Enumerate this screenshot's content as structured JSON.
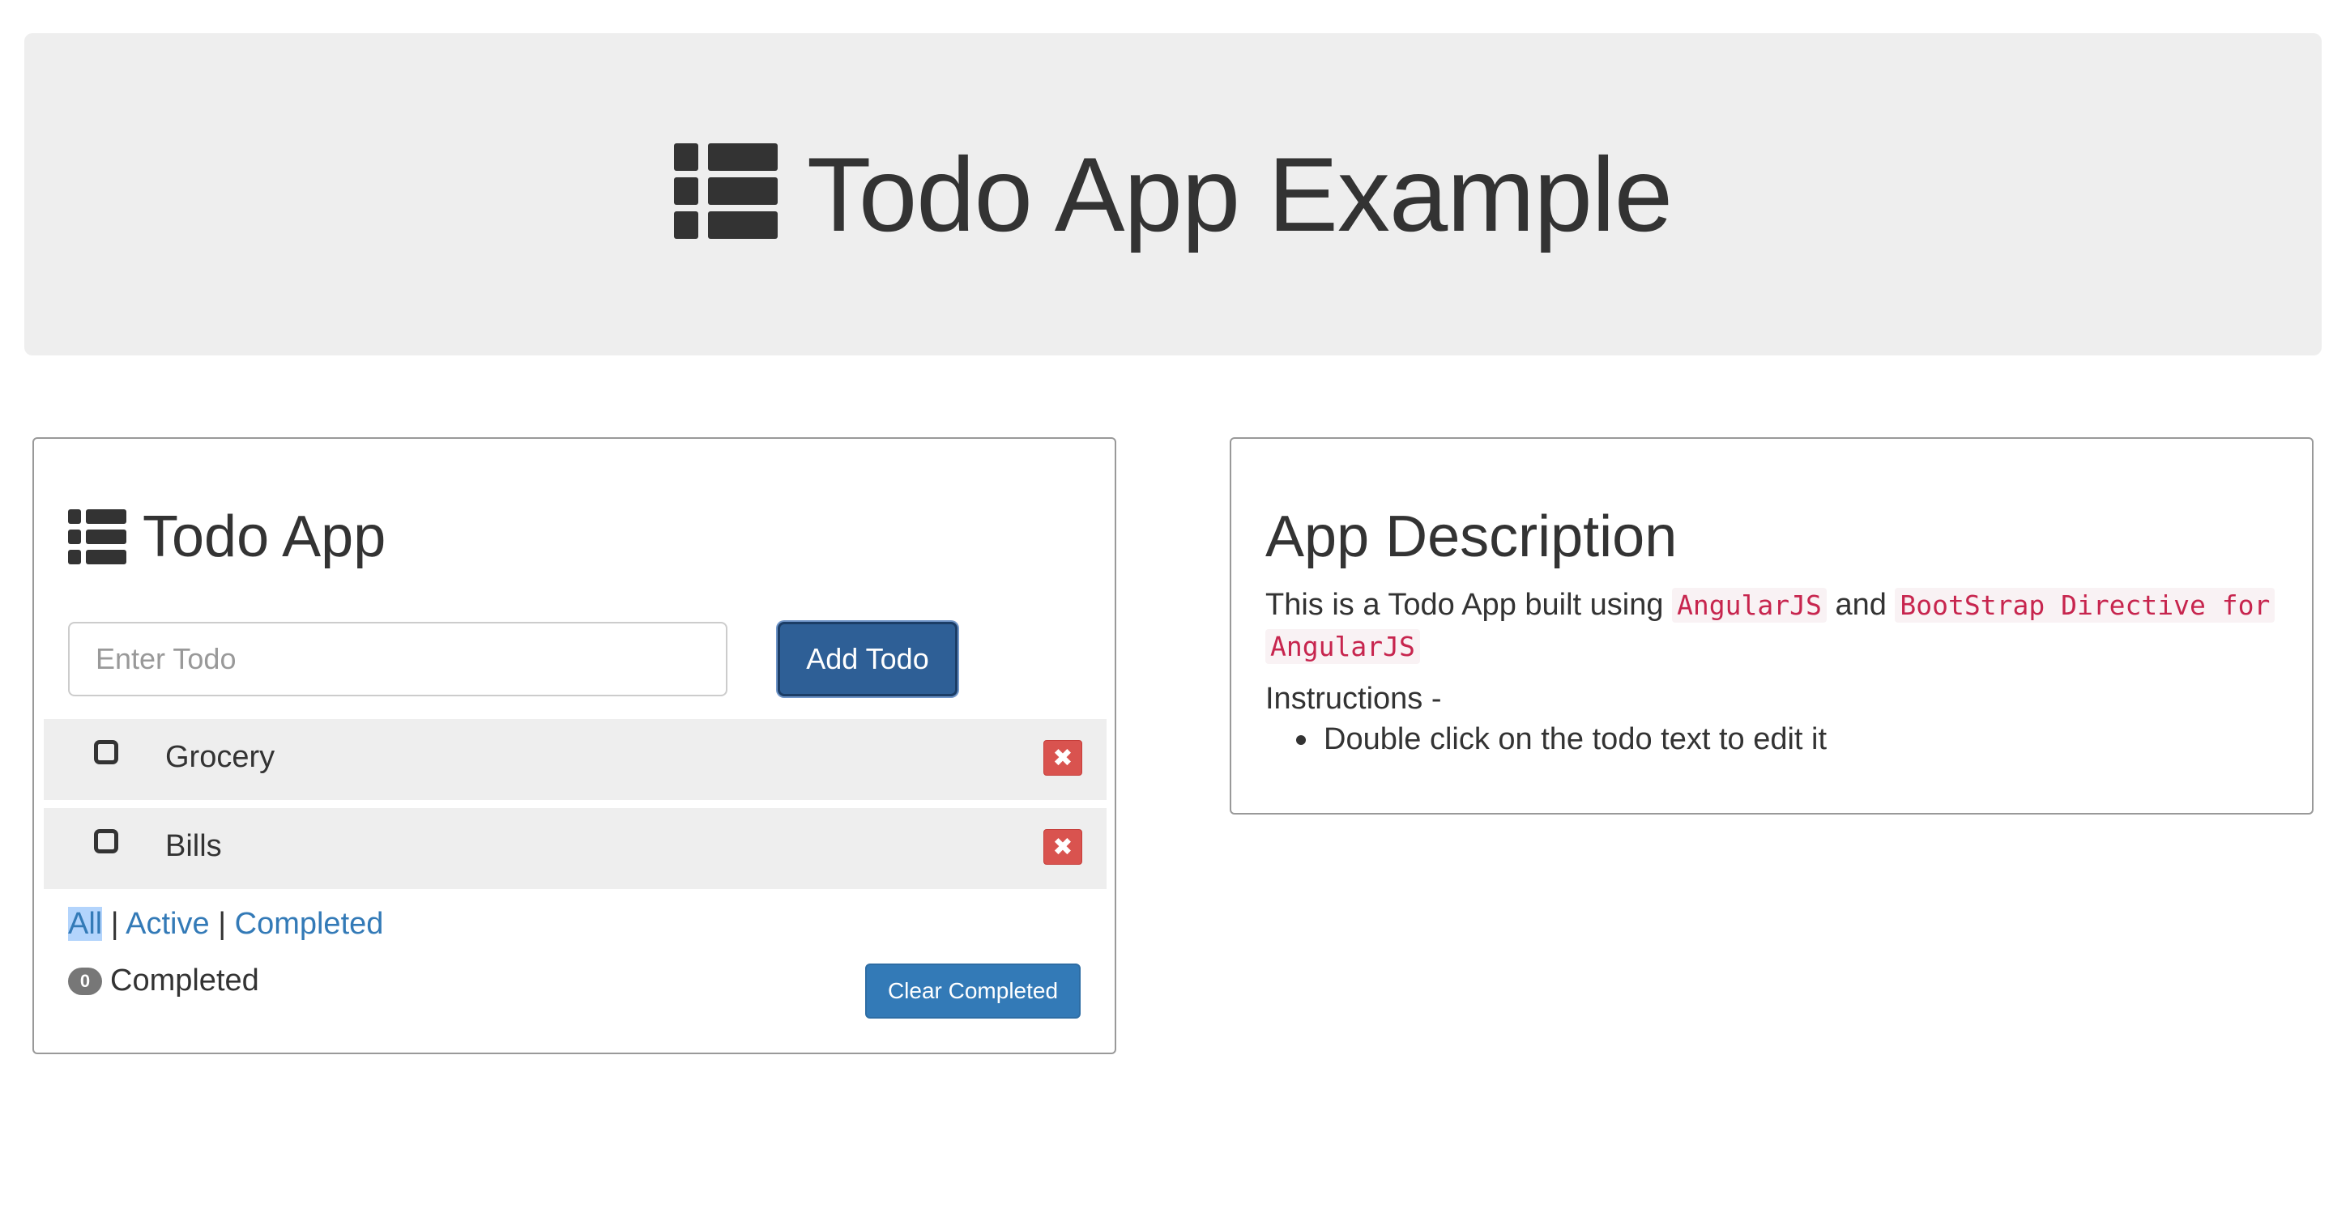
{
  "header": {
    "title": "Todo App Example",
    "icon": "list-icon"
  },
  "todo_panel": {
    "title": "Todo App",
    "icon": "list-icon",
    "input": {
      "value": "",
      "placeholder": "Enter Todo"
    },
    "add_button_label": "Add Todo",
    "items": [
      {
        "text": "Grocery",
        "checked": false,
        "delete_label": "✖"
      },
      {
        "text": "Bills",
        "checked": false,
        "delete_label": "✖"
      }
    ],
    "filters": {
      "all": "All",
      "separator": "|",
      "active": "Active",
      "completed": "Completed",
      "selected": "All"
    },
    "completed_count": "0",
    "completed_label": "Completed",
    "clear_button_label": "Clear Completed"
  },
  "description_panel": {
    "title": "App Description",
    "intro_prefix": "This is a Todo App built using",
    "code1": "AngularJS",
    "and_text": "and",
    "code2": "BootStrap Directive for",
    "code3": "AngularJS",
    "instructions_label": "Instructions -",
    "instructions": [
      "Double click on the todo text to edit it"
    ]
  },
  "colors": {
    "primary": "#337ab7",
    "primary_dark": "#2e5f96",
    "danger": "#d9534f",
    "jumbotron_bg": "#eeeeee",
    "code_text": "#c7254e"
  }
}
